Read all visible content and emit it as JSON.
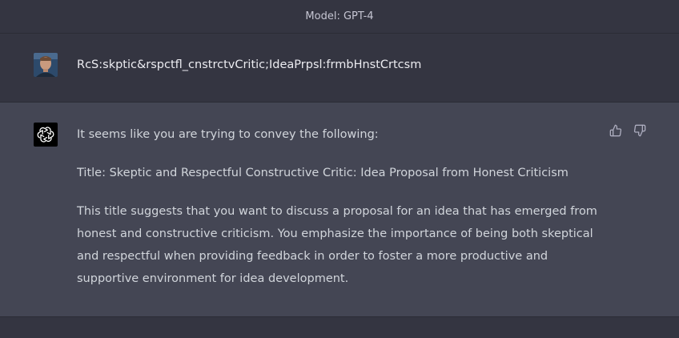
{
  "header": {
    "model_label": "Model: GPT-4"
  },
  "user_message": {
    "text": "RcS:skptic&rspctfl_cnstrctvCritic;IdeaPrpsl:frmbHnstCrtcsm"
  },
  "assistant_message": {
    "paragraphs": [
      "It seems like you are trying to convey the following:",
      "Title: Skeptic and Respectful Constructive Critic: Idea Proposal from Honest Criticism",
      "This title suggests that you want to discuss a proposal for an idea that has emerged from honest and constructive criticism. You emphasize the importance of being both skeptical and respectful when providing feedback in order to foster a more productive and supportive environment for idea development."
    ],
    "feedback_icons": [
      "thumbs-up-icon",
      "thumbs-down-icon"
    ]
  },
  "colors": {
    "background": "#343541",
    "assistant_background": "#444654",
    "text": "#d1d5db",
    "muted_text": "#c5c5d2"
  }
}
